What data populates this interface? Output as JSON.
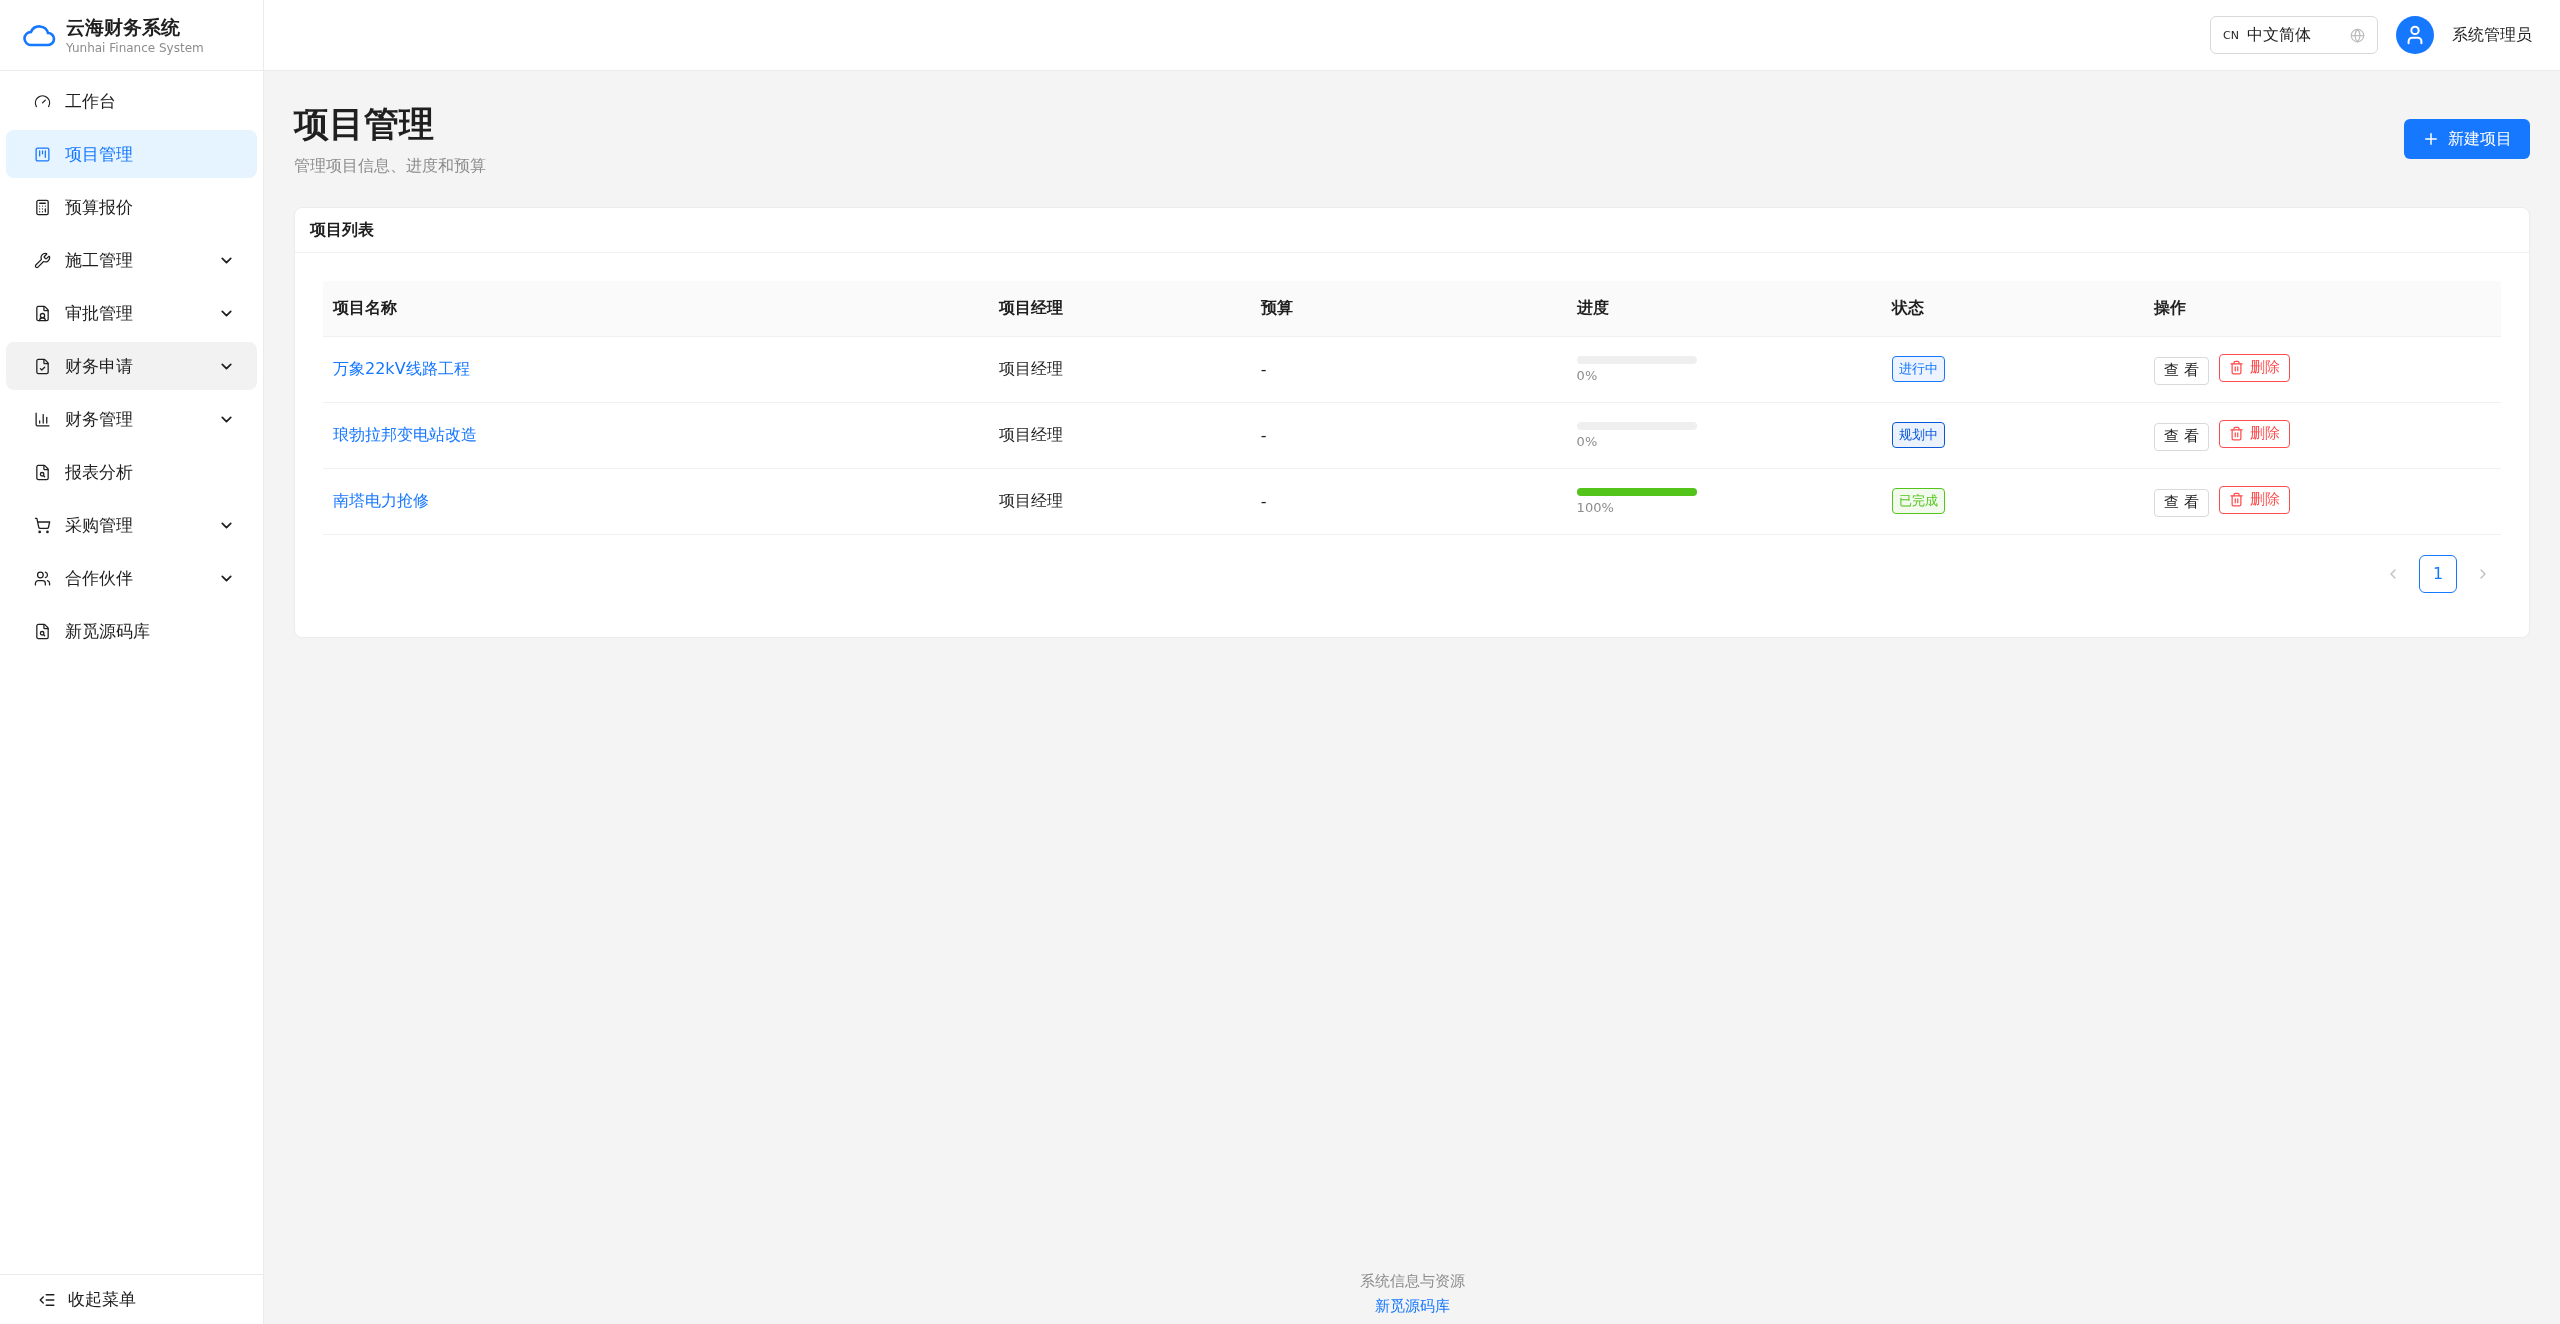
{
  "brand": {
    "name": "云海财务系统",
    "subtitle": "Yunhai Finance System"
  },
  "sidebar": {
    "items": [
      {
        "label": "工作台",
        "selected": false,
        "hovered": false,
        "expandable": false
      },
      {
        "label": "项目管理",
        "selected": true,
        "hovered": false,
        "expandable": false
      },
      {
        "label": "预算报价",
        "selected": false,
        "hovered": false,
        "expandable": false
      },
      {
        "label": "施工管理",
        "selected": false,
        "hovered": false,
        "expandable": true
      },
      {
        "label": "审批管理",
        "selected": false,
        "hovered": false,
        "expandable": true
      },
      {
        "label": "财务申请",
        "selected": false,
        "hovered": true,
        "expandable": true
      },
      {
        "label": "财务管理",
        "selected": false,
        "hovered": false,
        "expandable": true
      },
      {
        "label": "报表分析",
        "selected": false,
        "hovered": false,
        "expandable": false
      },
      {
        "label": "采购管理",
        "selected": false,
        "hovered": false,
        "expandable": true
      },
      {
        "label": "合作伙伴",
        "selected": false,
        "hovered": false,
        "expandable": true
      },
      {
        "label": "新觅源码库",
        "selected": false,
        "hovered": false,
        "expandable": false
      }
    ],
    "collapse": "收起菜单"
  },
  "header": {
    "language": {
      "code": "CN",
      "label": "中文简体"
    },
    "user": "系统管理员"
  },
  "page": {
    "title": "项目管理",
    "subtitle": "管理项目信息、进度和预算",
    "new_button": "新建项目"
  },
  "card": {
    "title": "项目列表",
    "table": {
      "columns": [
        "项目名称",
        "项目经理",
        "预算",
        "进度",
        "状态",
        "操作"
      ],
      "rows": [
        {
          "name": "万象22kV线路工程",
          "manager": "项目经理",
          "budget": "-",
          "level": 0,
          "progress": "0%",
          "status": {
            "label": "进行中",
            "color": "#1677ff"
          },
          "actions": [
            "查 看",
            "删除"
          ]
        },
        {
          "name": "琅勃拉邦变电站改造",
          "manager": "项目经理",
          "budget": "-",
          "level": 0,
          "progress": "0%",
          "status": {
            "label": "规划中",
            "color": "#0958d9"
          },
          "actions": [
            "查 看",
            "删除"
          ]
        },
        {
          "name": "南塔电力抢修",
          "manager": "项目经理",
          "budget": "-",
          "level": 1,
          "progress": "100%",
          "status": {
            "label": "已完成",
            "color": "#52c41a"
          },
          "actions": [
            "查 看",
            "删除"
          ]
        }
      ]
    },
    "pagination": {
      "pages": [
        {
          "label": "1",
          "selected": true
        }
      ]
    }
  },
  "footer": {
    "text": "系统信息与资源",
    "link": "新觅源码库"
  }
}
